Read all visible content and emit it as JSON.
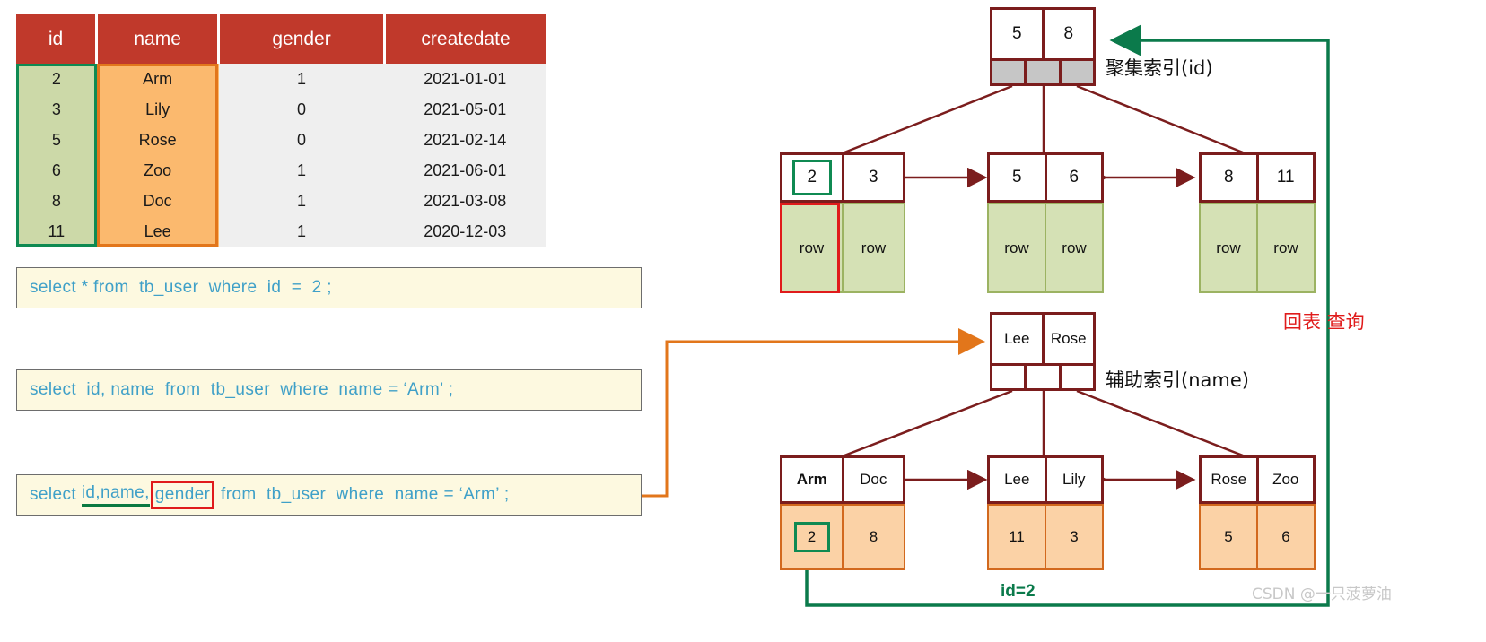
{
  "table": {
    "columns": [
      "id",
      "name",
      "gender",
      "createdate"
    ],
    "rows": [
      {
        "id": "2",
        "name": "Arm",
        "gender": "1",
        "createdate": "2021-01-01"
      },
      {
        "id": "3",
        "name": "Lily",
        "gender": "0",
        "createdate": "2021-05-01"
      },
      {
        "id": "5",
        "name": "Rose",
        "gender": "0",
        "createdate": "2021-02-14"
      },
      {
        "id": "6",
        "name": "Zoo",
        "gender": "1",
        "createdate": "2021-06-01"
      },
      {
        "id": "8",
        "name": "Doc",
        "gender": "1",
        "createdate": "2021-03-08"
      },
      {
        "id": "11",
        "name": "Lee",
        "gender": "1",
        "createdate": "2020-12-03"
      }
    ],
    "header_bg": "#c0392b",
    "id_col_bg": "#ccd9a8",
    "name_col_bg": "#fbb96e",
    "id_highlight_color": "#0f8a52",
    "name_highlight_color": "#e2761b"
  },
  "sql": {
    "stmt1": "select * from  tb_user  where  id  =  2 ;",
    "stmt2": "select  id, name  from  tb_user  where  name = ‘Arm’ ;",
    "stmt3": {
      "prefix": "select ",
      "underlined": "id,name,",
      "boxed": "gender",
      "suffix": " from  tb_user  where  name = ‘Arm’ ;"
    },
    "text_color": "#3fa0c8",
    "box_bg": "#fdf9e0"
  },
  "clustered_index": {
    "label": "聚集索引(id)",
    "root": {
      "keys": [
        "5",
        "8"
      ],
      "pointer_cells": 3,
      "pointer_fill": "#c6c6c6"
    },
    "leaves": [
      {
        "keys": [
          "2",
          "3"
        ],
        "data": [
          "row",
          "row"
        ],
        "key_highlight": "2",
        "data_highlight": "row"
      },
      {
        "keys": [
          "5",
          "6"
        ],
        "data": [
          "row",
          "row"
        ]
      },
      {
        "keys": [
          "8",
          "11"
        ],
        "data": [
          "row",
          "row"
        ]
      }
    ],
    "leaf_fill": "#d5e1b5"
  },
  "secondary_index": {
    "label": "辅助索引(name)",
    "root": {
      "keys": [
        "Lee",
        "Rose"
      ],
      "pointer_cells": 3,
      "pointer_fill": "#ffffff"
    },
    "leaves": [
      {
        "keys": [
          "Arm",
          "Doc"
        ],
        "data": [
          "2",
          "8"
        ],
        "key_bold": "Arm",
        "data_highlight": "2"
      },
      {
        "keys": [
          "Lee",
          "Lily"
        ],
        "data": [
          "11",
          "3"
        ]
      },
      {
        "keys": [
          "Rose",
          "Zoo"
        ],
        "data": [
          "5",
          "6"
        ]
      }
    ],
    "leaf_fill": "#fbd2a6"
  },
  "annotations": {
    "lookup_label": "回表 查询",
    "lookup_color": "#e01b1b",
    "id_eq": "id=2",
    "id_eq_color": "#0b7a4b",
    "green_path_color": "#0b7a4b",
    "orange_path_color": "#e2761b",
    "watermark": "CSDN @一只菠萝油"
  }
}
